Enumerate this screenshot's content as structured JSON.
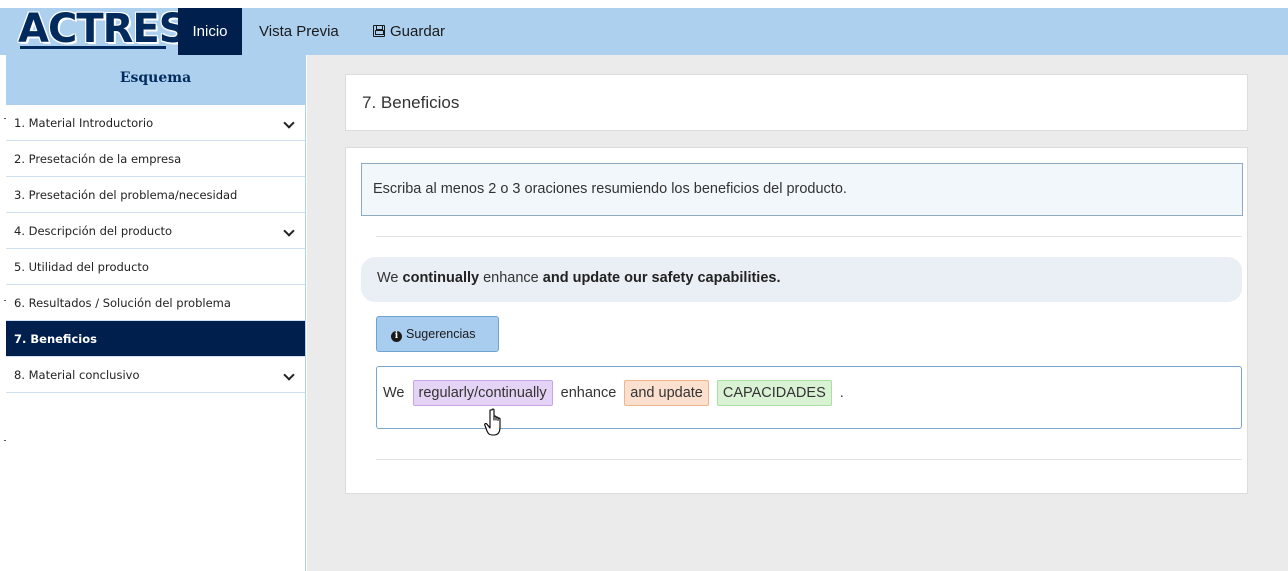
{
  "nav": {
    "logo": "ACTRES",
    "inicio": "Inicio",
    "vista_previa": "Vista Previa",
    "guardar": "Guardar",
    "guardar_icon": "save-icon"
  },
  "sidebar": {
    "header": "Esquema",
    "items": [
      {
        "label": "1. Material Introductorio",
        "expandable": true
      },
      {
        "label": "2. Presetación de la empresa",
        "expandable": false
      },
      {
        "label": "3. Presetación del problema/necesidad",
        "expandable": false
      },
      {
        "label": "4. Descripción del producto",
        "expandable": true
      },
      {
        "label": "5. Utilidad del producto",
        "expandable": false
      },
      {
        "label": "6. Resultados / Solución del problema",
        "expandable": false
      },
      {
        "label": "7. Beneficios",
        "expandable": false,
        "active": true
      },
      {
        "label": "8. Material conclusivo",
        "expandable": true
      }
    ]
  },
  "main": {
    "title": "7. Beneficios",
    "instruction": "Escriba al menos 2 o 3 oraciones resumiendo los beneficios del producto.",
    "sentence": {
      "parts": [
        "We ",
        "continually",
        " enhance ",
        "and update our safety capabilities."
      ]
    },
    "suggestions_button": "Sugerencias",
    "chunks": [
      {
        "text": "We",
        "type": "plain"
      },
      {
        "text": "regularly/continually",
        "type": "purple"
      },
      {
        "text": "enhance",
        "type": "plain"
      },
      {
        "text": "and update",
        "type": "orange"
      },
      {
        "text": "CAPACIDADES",
        "type": "green"
      },
      {
        "text": ".",
        "type": "plain"
      }
    ]
  },
  "colors": {
    "navbar": "#aed0ef",
    "active": "#001f4d",
    "purple_chunk": "#e5d3f5",
    "orange_chunk": "#fbe0cf",
    "green_chunk": "#d9f2d4"
  }
}
